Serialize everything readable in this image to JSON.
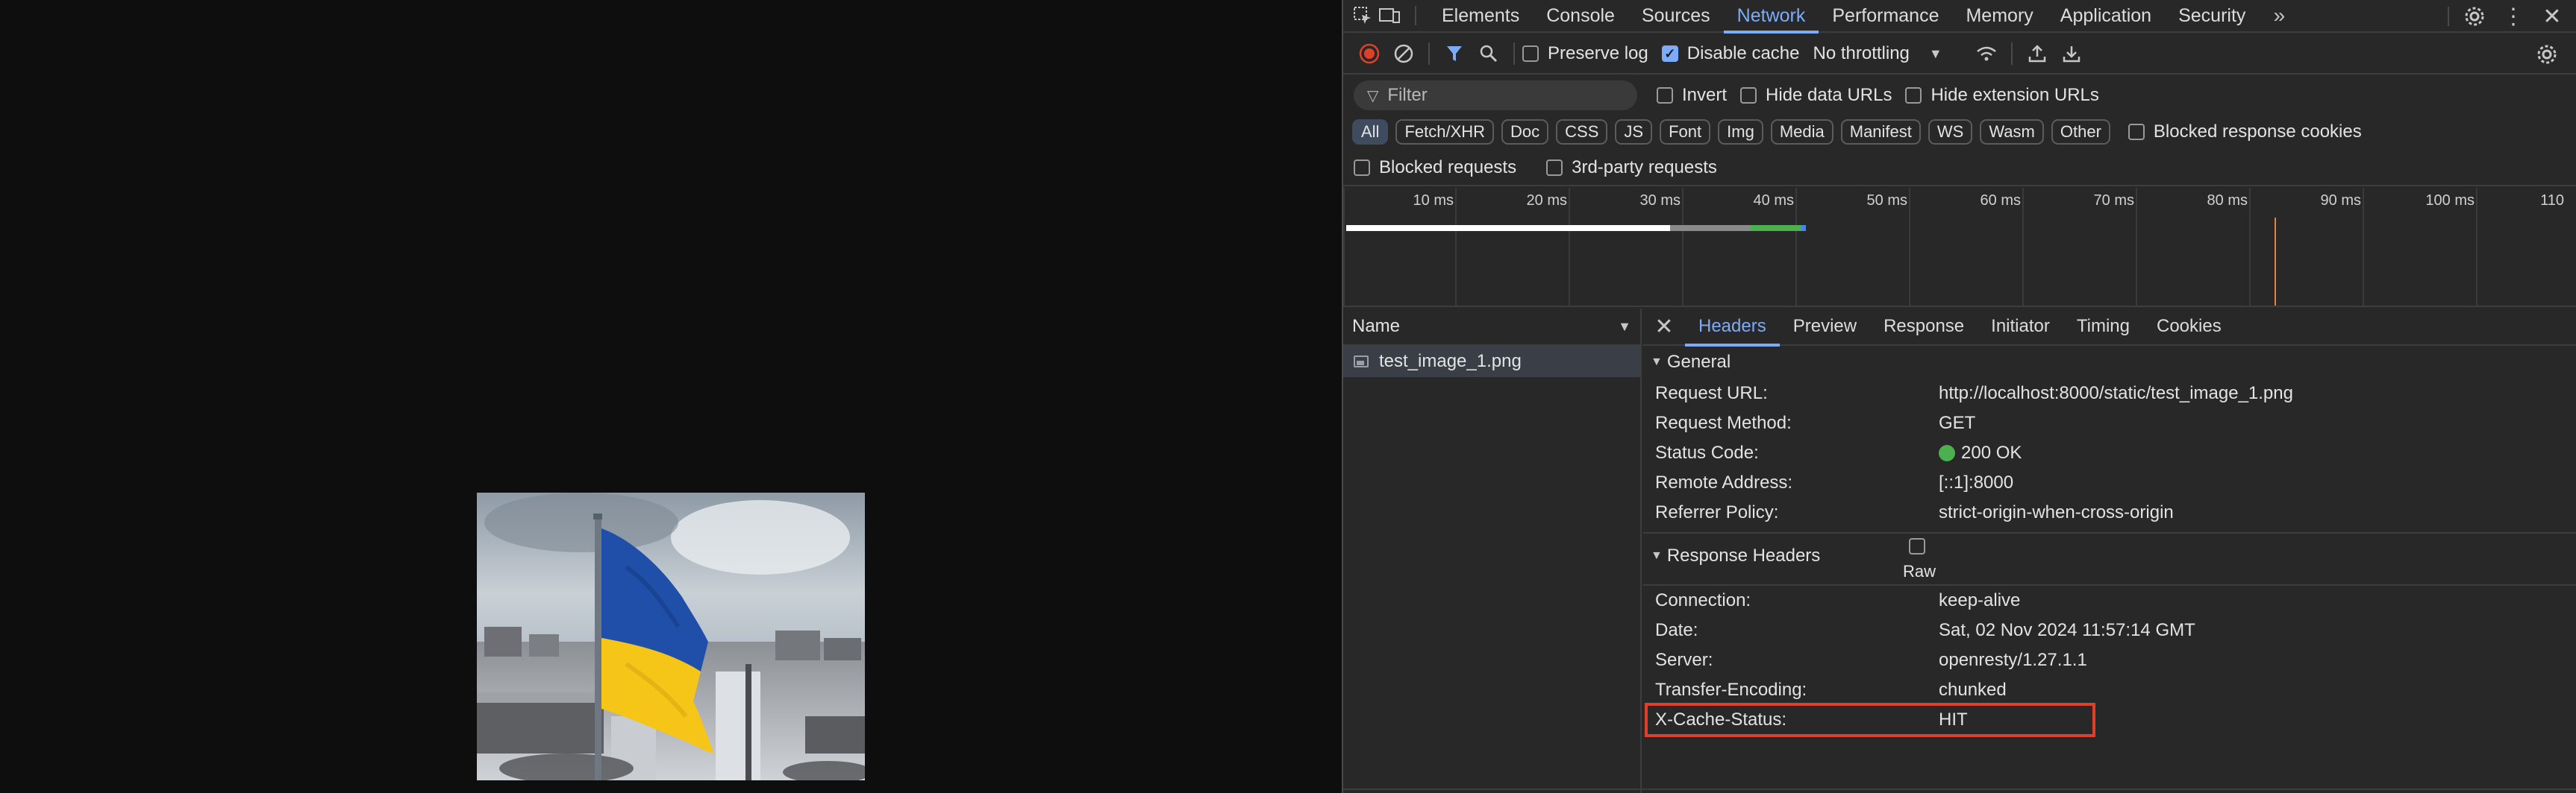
{
  "devtools": {
    "main_tabs": [
      "Elements",
      "Console",
      "Sources",
      "Network",
      "Performance",
      "Memory",
      "Application",
      "Security"
    ],
    "active_tab": "Network",
    "more_tabs_icon": "chevron-double-right-icon",
    "toolbar": {
      "preserve_log_label": "Preserve log",
      "preserve_log_checked": false,
      "disable_cache_label": "Disable cache",
      "disable_cache_checked": true,
      "throttling_value": "No throttling"
    },
    "filter": {
      "placeholder": "Filter",
      "invert_label": "Invert",
      "hide_data_urls_label": "Hide data URLs",
      "hide_extension_urls_label": "Hide extension URLs"
    },
    "type_filters": [
      "All",
      "Fetch/XHR",
      "Doc",
      "CSS",
      "JS",
      "Font",
      "Img",
      "Media",
      "Manifest",
      "WS",
      "Wasm",
      "Other"
    ],
    "active_type_filter": "All",
    "blocked_response_cookies_label": "Blocked response cookies",
    "blocked_requests_label": "Blocked requests",
    "third_party_requests_label": "3rd-party requests",
    "timeline_ticks": [
      "10 ms",
      "20 ms",
      "30 ms",
      "40 ms",
      "50 ms",
      "60 ms",
      "70 ms",
      "80 ms",
      "90 ms",
      "100 ms",
      "110"
    ],
    "timeline_colors": {
      "waiting": "#ffffff",
      "download": "#8a8a8a",
      "receive": "#4caf50",
      "end": "#4285f4",
      "load_marker": "#e8813c"
    },
    "request_list": {
      "column_header": "Name",
      "rows": [
        {
          "name": "test_image_1.png",
          "type_icon": "image-file-icon"
        }
      ]
    },
    "detail_tabs": [
      "Headers",
      "Preview",
      "Response",
      "Initiator",
      "Timing",
      "Cookies"
    ],
    "active_detail_tab": "Headers",
    "general": {
      "title": "General",
      "rows": [
        {
          "key": "Request URL:",
          "value": "http://localhost:8000/static/test_image_1.png"
        },
        {
          "key": "Request Method:",
          "value": "GET"
        },
        {
          "key": "Status Code:",
          "value": "200 OK"
        },
        {
          "key": "Remote Address:",
          "value": "[::1]:8000"
        },
        {
          "key": "Referrer Policy:",
          "value": "strict-origin-when-cross-origin"
        }
      ],
      "status_color": "#4caf50"
    },
    "response_headers": {
      "title": "Response Headers",
      "raw_label": "Raw",
      "rows": [
        {
          "key": "Connection:",
          "value": "keep-alive"
        },
        {
          "key": "Date:",
          "value": "Sat, 02 Nov 2024 11:57:14 GMT"
        },
        {
          "key": "Server:",
          "value": "openresty/1.27.1.1"
        },
        {
          "key": "Transfer-Encoding:",
          "value": "chunked"
        },
        {
          "key": "X-Cache-Status:",
          "value": "HIT"
        }
      ],
      "highlighted_key": "X-Cache-Status:",
      "highlight_color": "#e0402a"
    }
  },
  "viewport": {
    "image_subject": "ukrainian-flag-photo",
    "flag_colors": {
      "blue": "#1f4fa8",
      "yellow": "#f5c518"
    }
  }
}
